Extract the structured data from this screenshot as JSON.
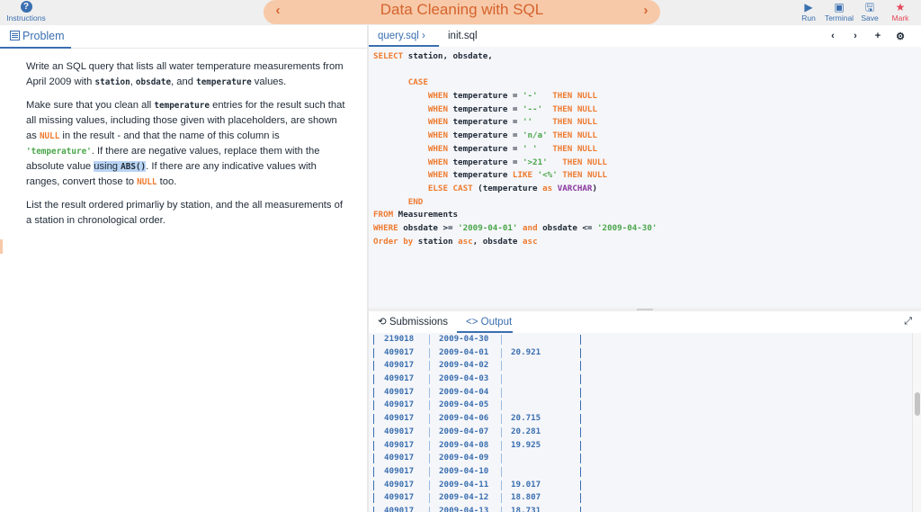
{
  "topbar": {
    "instructions_label": "Instructions",
    "instructions_icon": "question-circle-icon",
    "title": "Data Cleaning with SQL",
    "prev_icon": "‹",
    "next_icon": "›",
    "tools": [
      {
        "label": "Run",
        "icon": "▶",
        "icon_name": "play-icon"
      },
      {
        "label": "Terminal",
        "icon": "▣",
        "icon_name": "terminal-icon"
      },
      {
        "label": "Save",
        "icon": "🖫",
        "icon_name": "floppy-disk-icon"
      },
      {
        "label": "Mark",
        "icon": "★",
        "icon_name": "star-icon"
      }
    ]
  },
  "left": {
    "tab_label": "Problem",
    "p1": {
      "a": "Write an SQL query that lists all water temperature measurements from April 2009 with ",
      "code1": "station",
      "b": ", ",
      "code2": "obsdate",
      "c": ", and ",
      "code3": "temperature",
      "d": " values."
    },
    "p2": {
      "a": "Make sure that you clean all ",
      "code1": "temperature",
      "b": " entries for the result such that all missing values, including those given with placeholders, are shown as ",
      "null1": "NULL",
      "c": " in the result - and that the name of this column is ",
      "str1": "'temperature'",
      "d": ". If there are negative values, replace them with the absolute value ",
      "hl_text": "using ",
      "hl_code": "ABS()",
      "e": ". If there are any indicative values with ranges, convert those to ",
      "null2": "NULL",
      "f": " too."
    },
    "p3": "List the result ordered primarliy by station, and the all measurements of a station in chronological order."
  },
  "editor": {
    "tabs": [
      {
        "label": "query.sql ›",
        "active": true
      },
      {
        "label": "init.sql",
        "active": false
      }
    ],
    "controls": [
      "‹",
      "›",
      "+",
      "⚙"
    ],
    "code_lines": [
      [
        [
          "kw",
          "SELECT"
        ],
        [
          "t",
          " station, obsdate,"
        ]
      ],
      [
        [
          "t",
          ""
        ]
      ],
      [
        [
          "kw",
          "       CASE"
        ]
      ],
      [
        [
          "kw",
          "           WHEN"
        ],
        [
          "t",
          " temperature = "
        ],
        [
          "s",
          "'-'"
        ],
        [
          "t",
          "   "
        ],
        [
          "kw",
          "THEN NULL"
        ]
      ],
      [
        [
          "kw",
          "           WHEN"
        ],
        [
          "t",
          " temperature = "
        ],
        [
          "s",
          "'--'"
        ],
        [
          "t",
          "  "
        ],
        [
          "kw",
          "THEN NULL"
        ]
      ],
      [
        [
          "kw",
          "           WHEN"
        ],
        [
          "t",
          " temperature = "
        ],
        [
          "s",
          "''"
        ],
        [
          "t",
          "    "
        ],
        [
          "kw",
          "THEN NULL"
        ]
      ],
      [
        [
          "kw",
          "           WHEN"
        ],
        [
          "t",
          " temperature = "
        ],
        [
          "s",
          "'n/a'"
        ],
        [
          "t",
          " "
        ],
        [
          "kw",
          "THEN NULL"
        ]
      ],
      [
        [
          "kw",
          "           WHEN"
        ],
        [
          "t",
          " temperature = "
        ],
        [
          "s",
          "' '"
        ],
        [
          "t",
          "   "
        ],
        [
          "kw",
          "THEN NULL"
        ]
      ],
      [
        [
          "kw",
          "           WHEN"
        ],
        [
          "t",
          " temperature = "
        ],
        [
          "s",
          "'>21'"
        ],
        [
          "t",
          "   "
        ],
        [
          "kw",
          "THEN NULL"
        ]
      ],
      [
        [
          "kw",
          "           WHEN"
        ],
        [
          "t",
          " temperature "
        ],
        [
          "kw",
          "LIKE"
        ],
        [
          "t",
          " "
        ],
        [
          "s",
          "'<%'"
        ],
        [
          "t",
          " "
        ],
        [
          "kw",
          "THEN NULL"
        ]
      ],
      [
        [
          "kw",
          "           ELSE CAST"
        ],
        [
          "t",
          " (temperature "
        ],
        [
          "kw",
          "as"
        ],
        [
          "t",
          " "
        ],
        [
          "tp",
          "VARCHAR"
        ],
        [
          "t",
          ")"
        ]
      ],
      [
        [
          "kw",
          "       END"
        ]
      ],
      [
        [
          "kw",
          "FROM"
        ],
        [
          "t",
          " Measurements"
        ]
      ],
      [
        [
          "kw",
          "WHERE"
        ],
        [
          "t",
          " obsdate >= "
        ],
        [
          "s",
          "'2009-04-01'"
        ],
        [
          "t",
          " "
        ],
        [
          "kw",
          "and"
        ],
        [
          "t",
          " obsdate <= "
        ],
        [
          "s",
          "'2009-04-30'"
        ]
      ],
      [
        [
          "kw",
          "Order by"
        ],
        [
          "t",
          " station "
        ],
        [
          "kw",
          "asc"
        ],
        [
          "t",
          ", obsdate "
        ],
        [
          "kw",
          "asc"
        ]
      ]
    ]
  },
  "output": {
    "tabs": [
      {
        "label": "Submissions",
        "icon": "history-icon",
        "active": false
      },
      {
        "label": "Output",
        "icon": "code-icon",
        "active": true
      }
    ],
    "rows": [
      {
        "station": "219018",
        "obsdate": "2009-04-30",
        "temperature": ""
      },
      {
        "station": "409017",
        "obsdate": "2009-04-01",
        "temperature": "20.921"
      },
      {
        "station": "409017",
        "obsdate": "2009-04-02",
        "temperature": ""
      },
      {
        "station": "409017",
        "obsdate": "2009-04-03",
        "temperature": ""
      },
      {
        "station": "409017",
        "obsdate": "2009-04-04",
        "temperature": ""
      },
      {
        "station": "409017",
        "obsdate": "2009-04-05",
        "temperature": ""
      },
      {
        "station": "409017",
        "obsdate": "2009-04-06",
        "temperature": "20.715"
      },
      {
        "station": "409017",
        "obsdate": "2009-04-07",
        "temperature": "20.281"
      },
      {
        "station": "409017",
        "obsdate": "2009-04-08",
        "temperature": "19.925"
      },
      {
        "station": "409017",
        "obsdate": "2009-04-09",
        "temperature": ""
      },
      {
        "station": "409017",
        "obsdate": "2009-04-10",
        "temperature": ""
      },
      {
        "station": "409017",
        "obsdate": "2009-04-11",
        "temperature": "19.017"
      },
      {
        "station": "409017",
        "obsdate": "2009-04-12",
        "temperature": "18.807"
      },
      {
        "station": "409017",
        "obsdate": "2009-04-13",
        "temperature": "18.731"
      }
    ]
  },
  "colors": {
    "accent": "#3a6fb0",
    "title_pill": "#f7c9a8",
    "title_text": "#d5632d",
    "keyword": "#ee7b2f",
    "string": "#4aa64a",
    "type": "#8a3a9e",
    "mark": "#e5475a"
  }
}
